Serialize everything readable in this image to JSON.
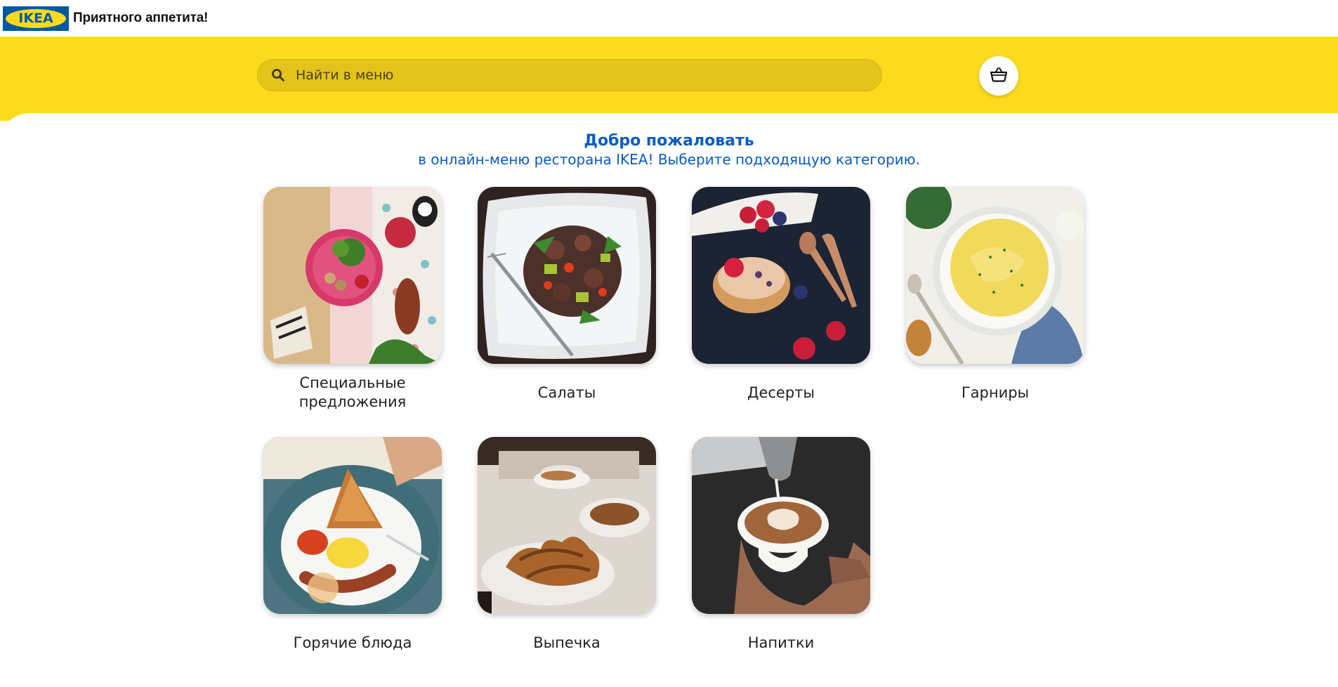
{
  "header": {
    "logo_text": "IKEA",
    "app_title": "Приятного аппетита!"
  },
  "search": {
    "placeholder": "Найти в меню",
    "value": ""
  },
  "welcome": {
    "title": "Добро пожаловать",
    "subtitle": "в онлайн-меню ресторана IKEA! Выберите подходящую категорию."
  },
  "categories": [
    {
      "label": "Специальные предложения",
      "image": "kids-plate-photo"
    },
    {
      "label": "Салаты",
      "image": "salad-photo"
    },
    {
      "label": "Десерты",
      "image": "tart-dessert-photo"
    },
    {
      "label": "Гарниры",
      "image": "mashed-potato-photo"
    },
    {
      "label": "Горячие блюда",
      "image": "breakfast-plate-photo"
    },
    {
      "label": "Выпечка",
      "image": "croissants-photo"
    },
    {
      "label": "Напитки",
      "image": "latte-photo"
    }
  ],
  "colors": {
    "brand_yellow": "#fcdb1f",
    "brand_blue": "#0058a3",
    "welcome_text": "#0a5bc5"
  },
  "icons": {
    "search": "search-icon",
    "cart": "basket-icon"
  }
}
